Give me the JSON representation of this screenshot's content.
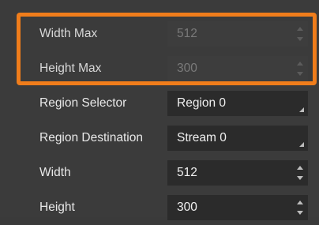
{
  "properties": [
    {
      "label": "Width Max",
      "value": "512",
      "control": "spinner",
      "enabled": false
    },
    {
      "label": "Height Max",
      "value": "300",
      "control": "spinner",
      "enabled": false
    },
    {
      "label": "Region Selector",
      "value": "Region 0",
      "control": "combo",
      "enabled": true
    },
    {
      "label": "Region Destination",
      "value": "Stream 0",
      "control": "combo",
      "enabled": true
    },
    {
      "label": "Width",
      "value": "512",
      "control": "spinner",
      "enabled": true
    },
    {
      "label": "Height",
      "value": "300",
      "control": "spinner",
      "enabled": true
    }
  ],
  "colors": {
    "highlight": "#f07d1b",
    "panel_background": "#3b3b3b",
    "field_background": "#2b2b2b"
  }
}
